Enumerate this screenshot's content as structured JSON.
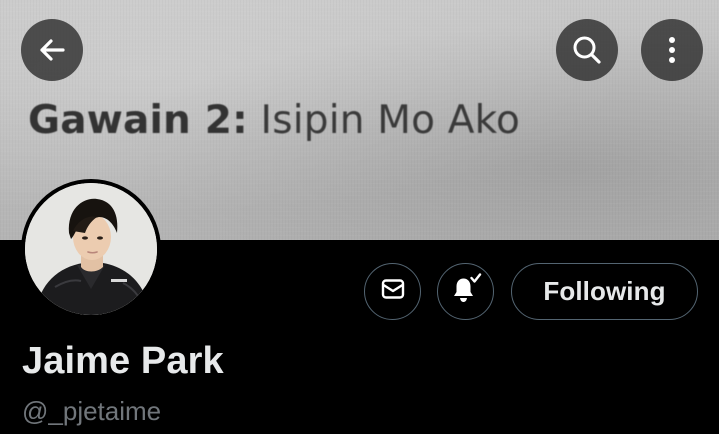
{
  "banner": {
    "title_bold": "Gawain 2:",
    "title_rest": " Isipin Mo Ako"
  },
  "nav": {
    "back_icon": "arrow-left-icon",
    "search_icon": "search-icon",
    "more_icon": "more-vertical-icon"
  },
  "profile": {
    "display_name": "Jaime Park",
    "handle": "@_pjetaime",
    "avatar_icon": "avatar"
  },
  "actions": {
    "message_icon": "mail-icon",
    "notify_icon": "bell-check-icon",
    "following_label": "Following"
  },
  "colors": {
    "background": "#000000",
    "text_primary": "#e7e9ea",
    "text_secondary": "#71767b",
    "button_border": "#536471",
    "overlay_button": "#282828"
  }
}
